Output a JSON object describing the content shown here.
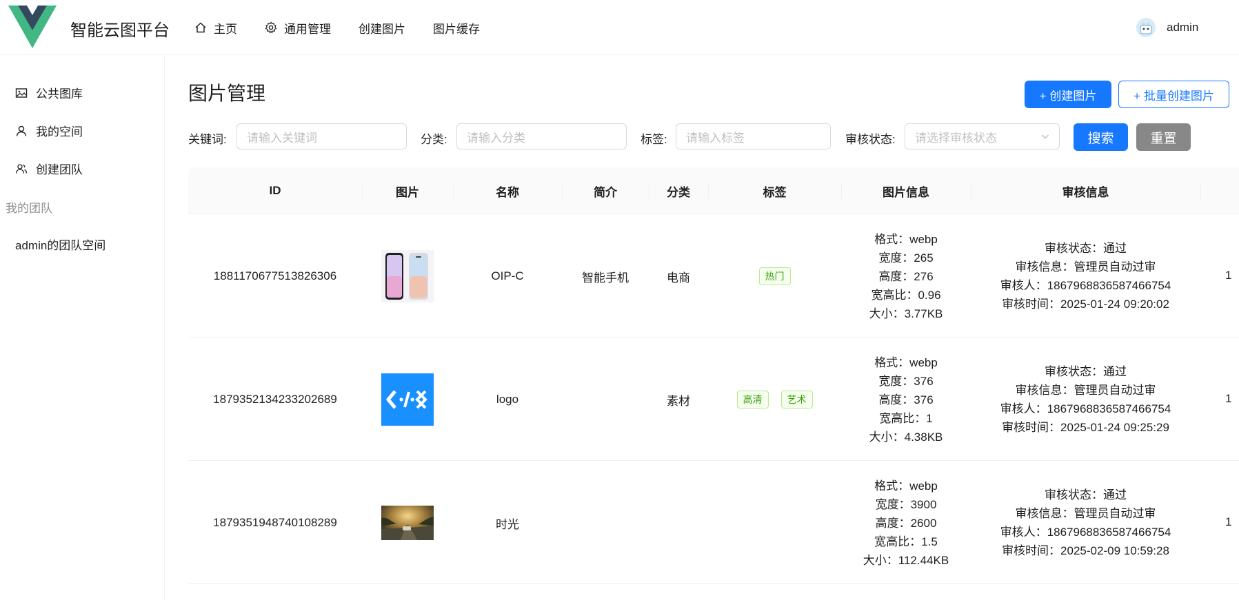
{
  "header": {
    "brand": "智能云图平台",
    "nav": [
      {
        "label": "主页",
        "icon": "home-icon"
      },
      {
        "label": "通用管理",
        "icon": "gear-icon"
      },
      {
        "label": "创建图片",
        "icon": ""
      },
      {
        "label": "图片缓存",
        "icon": ""
      }
    ],
    "user": {
      "name": "admin"
    }
  },
  "sidebar": {
    "items": [
      {
        "label": "公共图库",
        "icon": "picture-icon"
      },
      {
        "label": "我的空间",
        "icon": "user-icon"
      },
      {
        "label": "创建团队",
        "icon": "team-icon"
      }
    ],
    "group_label": "我的团队",
    "group_items": [
      {
        "label": "admin的团队空间"
      }
    ]
  },
  "main": {
    "title": "图片管理",
    "create_button": "+ 创建图片",
    "batch_button": "+ 批量创建图片",
    "filters": {
      "keyword_label": "关键词:",
      "keyword_placeholder": "请输入关键词",
      "category_label": "分类:",
      "category_placeholder": "请输入分类",
      "tags_label": "标签:",
      "tags_placeholder": "请输入标签",
      "review_label": "审核状态:",
      "review_placeholder": "请选择审核状态",
      "search_button": "搜索",
      "reset_button": "重置"
    },
    "table": {
      "columns": [
        "ID",
        "图片",
        "名称",
        "简介",
        "分类",
        "标签",
        "图片信息",
        "审核信息"
      ],
      "rows": [
        {
          "id": "1881170677513826306",
          "thumbnail": "phones",
          "name": "OIP-C",
          "intro": "智能手机",
          "category": "电商",
          "tags": [
            "热门"
          ],
          "info": [
            "格式：webp",
            "宽度：265",
            "高度：276",
            "宽高比：0.96",
            "大小：3.77KB"
          ],
          "review": [
            "审核状态：通过",
            "审核信息：管理员自动过审",
            "审核人：1867968836587466754",
            "审核时间：2025-01-24 09:20:02"
          ],
          "overflow": "1"
        },
        {
          "id": "1879352134233202689",
          "thumbnail": "logo",
          "name": "logo",
          "intro": "",
          "category": "素材",
          "tags": [
            "高清",
            "艺术"
          ],
          "info": [
            "格式：webp",
            "宽度：376",
            "高度：376",
            "宽高比：1",
            "大小：4.38KB"
          ],
          "review": [
            "审核状态：通过",
            "审核信息：管理员自动过审",
            "审核人：1867968836587466754",
            "审核时间：2025-01-24 09:25:29"
          ],
          "overflow": "1"
        },
        {
          "id": "1879351948740108289",
          "thumbnail": "road",
          "name": "时光",
          "intro": "",
          "category": "",
          "tags": [],
          "info": [
            "格式：webp",
            "宽度：3900",
            "高度：2600",
            "宽高比：1.5",
            "大小：112.44KB"
          ],
          "review": [
            "审核状态：通过",
            "审核信息：管理员自动过审",
            "审核人：1867968836587466754",
            "审核时间：2025-02-09 10:59:28"
          ],
          "overflow": "1"
        }
      ]
    }
  },
  "colors": {
    "primary": "#1677ff",
    "reset": "#888888",
    "tag_text": "#389e0d",
    "tag_bg": "#f6ffed",
    "tag_border": "#b7eb8f",
    "logo_green": "#41b883",
    "logo_dark": "#35495e"
  }
}
